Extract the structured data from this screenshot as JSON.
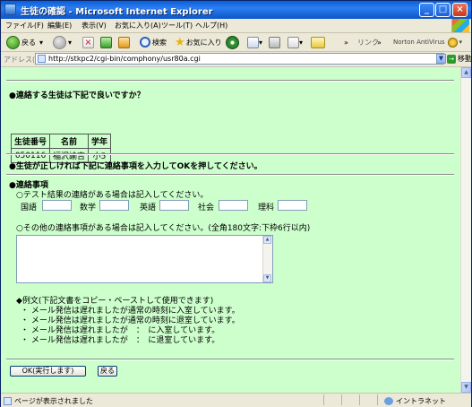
{
  "window": {
    "title": "生徒の確認 - Microsoft Internet Explorer"
  },
  "menu": [
    "ファイル(F)",
    "編集(E)",
    "表示(V)",
    "お気に入り(A)",
    "ツール(T)",
    "ヘルプ(H)"
  ],
  "toolbar": {
    "back": "戻る",
    "search": "検索",
    "favorites": "お気に入り",
    "more": "»",
    "links": "リンク",
    "more2": "»",
    "norton": "Norton AntiVirus"
  },
  "address": {
    "label": "アドレス(D)",
    "url": "http://stkpc2/cgi-bin/comphony/usr80a.cgi",
    "go": "移動"
  },
  "page": {
    "confirm_heading": "●連絡する生徒は下記で良いですか？",
    "table": {
      "headers": [
        "生徒番号",
        "名前",
        "学年"
      ],
      "rows": [
        [
          "050116",
          "福沢諭吉",
          "小5"
        ]
      ]
    },
    "instruction": "●生徒が正しければ下記に連絡事項を入力してOKを押してください。",
    "contact_heading": "●連絡事項",
    "test_note": "○テスト結果の連絡がある場合は記入してください。",
    "subjects": [
      "国語",
      "数学",
      "英語",
      "社会",
      "理科"
    ],
    "other_note": "○その他の連絡事項がある場合は記入してください。(全角180文字:下枠6行以内)",
    "example_heading": "◆例文(下記文書をコピー・ペーストして使用できます)",
    "examples": [
      "・ メール発信は遅れましたが通常の時刻に入室しています。",
      "・ メール発信は遅れましたが通常の時刻に退室しています。",
      "・ メール発信は遅れましたが　：　に入室しています。",
      "・ メール発信は遅れましたが　：　に退室しています。"
    ],
    "ok_button": "OK(実行します)",
    "back_button": "戻る"
  },
  "status": {
    "text": "ページが表示されました",
    "zone": "イントラネット"
  }
}
